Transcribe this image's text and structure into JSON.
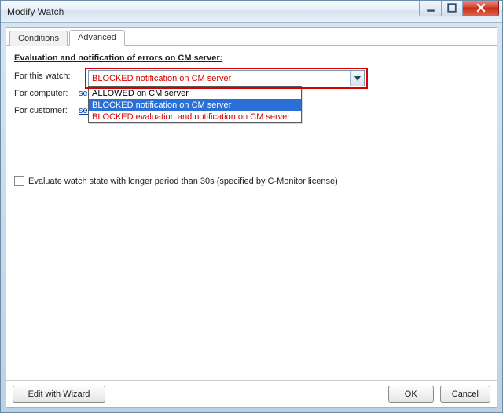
{
  "window": {
    "title": "Modify Watch"
  },
  "tabs": {
    "conditions": "Conditions",
    "advanced": "Advanced",
    "active": "advanced"
  },
  "section": {
    "heading": "Evaluation and notification of errors on CM server:",
    "rows": {
      "watch_label": "For this watch:",
      "computer_label": "For computer:",
      "computer_link": "set",
      "customer_label": "For customer:",
      "customer_link": "set"
    }
  },
  "dropdown": {
    "selected": "BLOCKED notification on CM server",
    "options": [
      {
        "text": "ALLOWED on CM server",
        "state": "allowed"
      },
      {
        "text": "BLOCKED notification on CM server",
        "state": "selected"
      },
      {
        "text": "BLOCKED evaluation and notification on CM server",
        "state": "red"
      }
    ]
  },
  "checkbox": {
    "label": "Evaluate watch state with longer period than 30s (specified by C-Monitor license)",
    "checked": false
  },
  "buttons": {
    "wizard": "Edit with Wizard",
    "ok": "OK",
    "cancel": "Cancel"
  }
}
